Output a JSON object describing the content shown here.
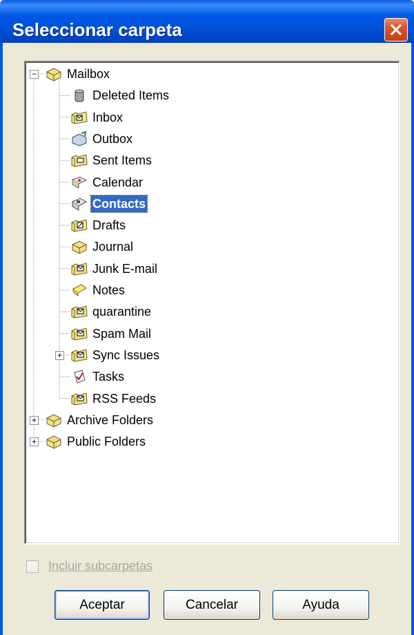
{
  "window": {
    "title": "Seleccionar carpeta",
    "close_glyph": "✕"
  },
  "tree": {
    "expand_glyph": "+",
    "collapse_glyph": "−",
    "items": [
      {
        "label": "Mailbox",
        "level": 0,
        "expander": "collapse",
        "icon": "mailbox-icon",
        "selected": false
      },
      {
        "label": "Deleted Items",
        "level": 1,
        "expander": "none",
        "icon": "trash-folder-icon",
        "selected": false
      },
      {
        "label": "Inbox",
        "level": 1,
        "expander": "none",
        "icon": "inbox-icon",
        "selected": false
      },
      {
        "label": "Outbox",
        "level": 1,
        "expander": "none",
        "icon": "outbox-icon",
        "selected": false
      },
      {
        "label": "Sent Items",
        "level": 1,
        "expander": "none",
        "icon": "sent-folder-icon",
        "selected": false
      },
      {
        "label": "Calendar",
        "level": 1,
        "expander": "none",
        "icon": "calendar-icon",
        "selected": false
      },
      {
        "label": "Contacts",
        "level": 1,
        "expander": "none",
        "icon": "contacts-icon",
        "selected": true
      },
      {
        "label": "Drafts",
        "level": 1,
        "expander": "none",
        "icon": "drafts-icon",
        "selected": false
      },
      {
        "label": "Journal",
        "level": 1,
        "expander": "none",
        "icon": "journal-icon",
        "selected": false
      },
      {
        "label": "Junk E-mail",
        "level": 1,
        "expander": "none",
        "icon": "mail-folder-icon",
        "selected": false
      },
      {
        "label": "Notes",
        "level": 1,
        "expander": "none",
        "icon": "notes-icon",
        "selected": false
      },
      {
        "label": "quarantine",
        "level": 1,
        "expander": "none",
        "icon": "mail-folder-icon",
        "selected": false
      },
      {
        "label": "Spam Mail",
        "level": 1,
        "expander": "none",
        "icon": "mail-folder-icon",
        "selected": false
      },
      {
        "label": "Sync Issues",
        "level": 1,
        "expander": "expand",
        "icon": "mail-folder-icon",
        "selected": false
      },
      {
        "label": "Tasks",
        "level": 1,
        "expander": "none",
        "icon": "tasks-icon",
        "selected": false
      },
      {
        "label": "RSS Feeds",
        "level": 1,
        "expander": "none",
        "icon": "mail-folder-icon",
        "selected": false
      },
      {
        "label": "Archive Folders",
        "level": 0,
        "expander": "expand",
        "icon": "mailbox-icon",
        "selected": false
      },
      {
        "label": "Public Folders",
        "level": 0,
        "expander": "expand",
        "icon": "mailbox-icon",
        "selected": false
      }
    ]
  },
  "options": {
    "include_subfolders_label": "Incluir subcarpetas",
    "include_subfolders_checked": false,
    "include_subfolders_enabled": false
  },
  "buttons": {
    "ok_label": "Aceptar",
    "cancel_label": "Cancelar",
    "help_label": "Ayuda"
  }
}
